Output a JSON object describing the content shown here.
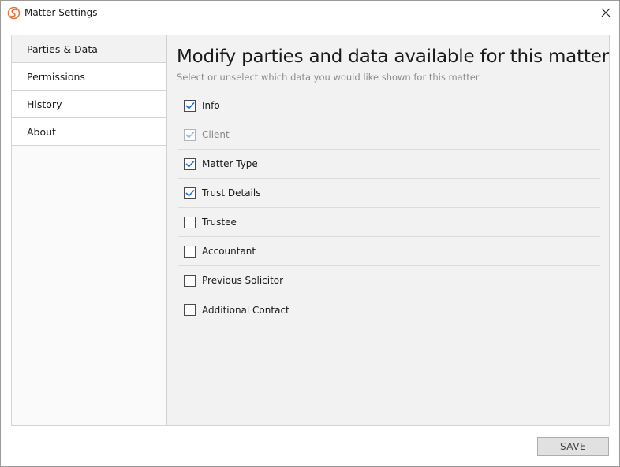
{
  "window": {
    "title": "Matter Settings",
    "app_icon": "app-logo-icon",
    "close_icon": "close-icon"
  },
  "sidebar": {
    "items": [
      {
        "label": "Parties & Data",
        "active": true
      },
      {
        "label": "Permissions",
        "active": false
      },
      {
        "label": "History",
        "active": false
      },
      {
        "label": "About",
        "active": false
      }
    ]
  },
  "main": {
    "heading": "Modify parties and data available for this matter",
    "subheading": "Select or unselect which data you would like shown for this matter",
    "options": [
      {
        "label": "Info",
        "checked": true,
        "disabled": false
      },
      {
        "label": "Client",
        "checked": true,
        "disabled": true
      },
      {
        "label": "Matter Type",
        "checked": true,
        "disabled": false
      },
      {
        "label": "Trust Details",
        "checked": true,
        "disabled": false
      },
      {
        "label": "Trustee",
        "checked": false,
        "disabled": false
      },
      {
        "label": "Accountant",
        "checked": false,
        "disabled": false
      },
      {
        "label": "Previous Solicitor",
        "checked": false,
        "disabled": false
      },
      {
        "label": "Additional Contact",
        "checked": false,
        "disabled": false
      }
    ]
  },
  "footer": {
    "save_label": "SAVE"
  },
  "colors": {
    "accent": "#e8743b",
    "check_blue": "#1a6fd6",
    "check_disabled": "#9bb8dc"
  }
}
